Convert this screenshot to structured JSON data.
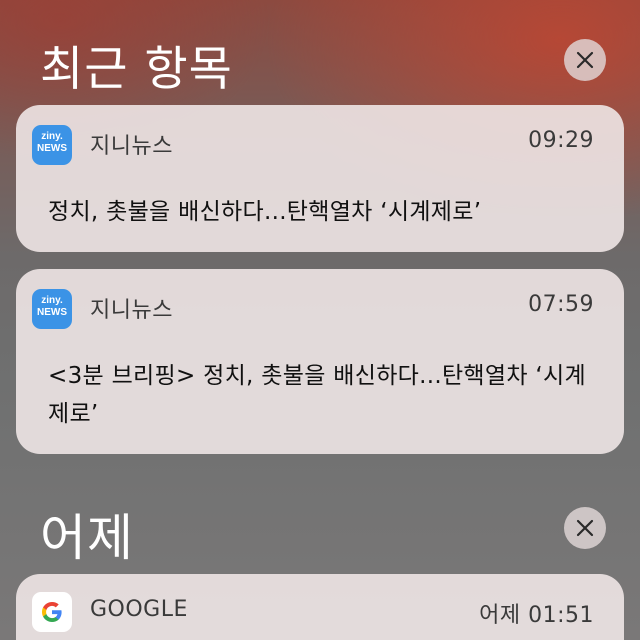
{
  "sections": {
    "recent": {
      "title": "최근 항목",
      "clear_icon": "close-icon"
    },
    "yesterday": {
      "title": "어제",
      "clear_icon": "close-icon"
    }
  },
  "notifications": [
    {
      "app": "지니뉴스",
      "icon": "ziny-news-icon",
      "icon_text_top": "ziny.",
      "icon_text_bottom": "NEWS",
      "time": "09:29",
      "message": "정치, 촛불을 배신하다...탄핵열차 ‘시계제로’"
    },
    {
      "app": "지니뉴스",
      "icon": "ziny-news-icon",
      "icon_text_top": "ziny.",
      "icon_text_bottom": "NEWS",
      "time": "07:59",
      "message": "<3분 브리핑> 정치, 촛불을 배신하다...탄핵열차 ‘시계제로’"
    },
    {
      "app": "GOOGLE",
      "icon": "google-icon",
      "time": "어제 01:51"
    }
  ],
  "colors": {
    "card_background": "#eee6e6",
    "ziny_icon_background": "#3b93e6",
    "header_text": "#ffffff"
  }
}
